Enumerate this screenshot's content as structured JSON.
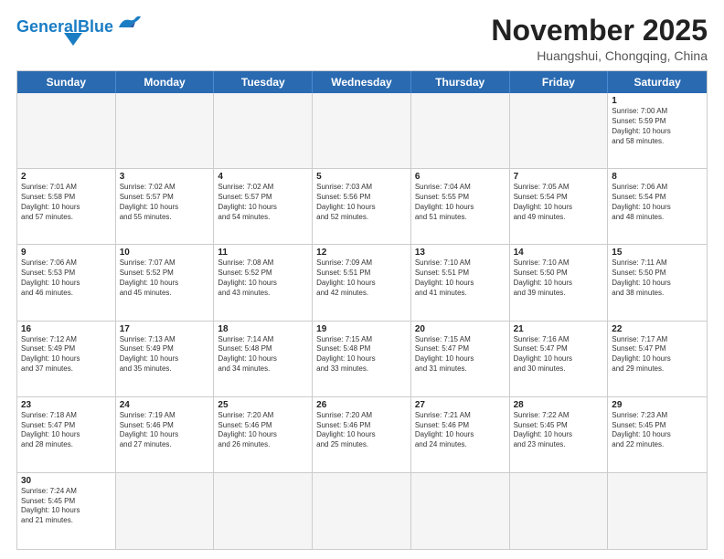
{
  "header": {
    "logo_general": "General",
    "logo_blue": "Blue",
    "month_title": "November 2025",
    "location": "Huangshui, Chongqing, China"
  },
  "days": [
    "Sunday",
    "Monday",
    "Tuesday",
    "Wednesday",
    "Thursday",
    "Friday",
    "Saturday"
  ],
  "cells": [
    {
      "day": "",
      "empty": true,
      "info": ""
    },
    {
      "day": "",
      "empty": true,
      "info": ""
    },
    {
      "day": "",
      "empty": true,
      "info": ""
    },
    {
      "day": "",
      "empty": true,
      "info": ""
    },
    {
      "day": "",
      "empty": true,
      "info": ""
    },
    {
      "day": "",
      "empty": true,
      "info": ""
    },
    {
      "day": "1",
      "empty": false,
      "info": "Sunrise: 7:00 AM\nSunset: 5:59 PM\nDaylight: 10 hours\nand 58 minutes."
    },
    {
      "day": "2",
      "empty": false,
      "info": "Sunrise: 7:01 AM\nSunset: 5:58 PM\nDaylight: 10 hours\nand 57 minutes."
    },
    {
      "day": "3",
      "empty": false,
      "info": "Sunrise: 7:02 AM\nSunset: 5:57 PM\nDaylight: 10 hours\nand 55 minutes."
    },
    {
      "day": "4",
      "empty": false,
      "info": "Sunrise: 7:02 AM\nSunset: 5:57 PM\nDaylight: 10 hours\nand 54 minutes."
    },
    {
      "day": "5",
      "empty": false,
      "info": "Sunrise: 7:03 AM\nSunset: 5:56 PM\nDaylight: 10 hours\nand 52 minutes."
    },
    {
      "day": "6",
      "empty": false,
      "info": "Sunrise: 7:04 AM\nSunset: 5:55 PM\nDaylight: 10 hours\nand 51 minutes."
    },
    {
      "day": "7",
      "empty": false,
      "info": "Sunrise: 7:05 AM\nSunset: 5:54 PM\nDaylight: 10 hours\nand 49 minutes."
    },
    {
      "day": "8",
      "empty": false,
      "info": "Sunrise: 7:06 AM\nSunset: 5:54 PM\nDaylight: 10 hours\nand 48 minutes."
    },
    {
      "day": "9",
      "empty": false,
      "info": "Sunrise: 7:06 AM\nSunset: 5:53 PM\nDaylight: 10 hours\nand 46 minutes."
    },
    {
      "day": "10",
      "empty": false,
      "info": "Sunrise: 7:07 AM\nSunset: 5:52 PM\nDaylight: 10 hours\nand 45 minutes."
    },
    {
      "day": "11",
      "empty": false,
      "info": "Sunrise: 7:08 AM\nSunset: 5:52 PM\nDaylight: 10 hours\nand 43 minutes."
    },
    {
      "day": "12",
      "empty": false,
      "info": "Sunrise: 7:09 AM\nSunset: 5:51 PM\nDaylight: 10 hours\nand 42 minutes."
    },
    {
      "day": "13",
      "empty": false,
      "info": "Sunrise: 7:10 AM\nSunset: 5:51 PM\nDaylight: 10 hours\nand 41 minutes."
    },
    {
      "day": "14",
      "empty": false,
      "info": "Sunrise: 7:10 AM\nSunset: 5:50 PM\nDaylight: 10 hours\nand 39 minutes."
    },
    {
      "day": "15",
      "empty": false,
      "info": "Sunrise: 7:11 AM\nSunset: 5:50 PM\nDaylight: 10 hours\nand 38 minutes."
    },
    {
      "day": "16",
      "empty": false,
      "info": "Sunrise: 7:12 AM\nSunset: 5:49 PM\nDaylight: 10 hours\nand 37 minutes."
    },
    {
      "day": "17",
      "empty": false,
      "info": "Sunrise: 7:13 AM\nSunset: 5:49 PM\nDaylight: 10 hours\nand 35 minutes."
    },
    {
      "day": "18",
      "empty": false,
      "info": "Sunrise: 7:14 AM\nSunset: 5:48 PM\nDaylight: 10 hours\nand 34 minutes."
    },
    {
      "day": "19",
      "empty": false,
      "info": "Sunrise: 7:15 AM\nSunset: 5:48 PM\nDaylight: 10 hours\nand 33 minutes."
    },
    {
      "day": "20",
      "empty": false,
      "info": "Sunrise: 7:15 AM\nSunset: 5:47 PM\nDaylight: 10 hours\nand 31 minutes."
    },
    {
      "day": "21",
      "empty": false,
      "info": "Sunrise: 7:16 AM\nSunset: 5:47 PM\nDaylight: 10 hours\nand 30 minutes."
    },
    {
      "day": "22",
      "empty": false,
      "info": "Sunrise: 7:17 AM\nSunset: 5:47 PM\nDaylight: 10 hours\nand 29 minutes."
    },
    {
      "day": "23",
      "empty": false,
      "info": "Sunrise: 7:18 AM\nSunset: 5:47 PM\nDaylight: 10 hours\nand 28 minutes."
    },
    {
      "day": "24",
      "empty": false,
      "info": "Sunrise: 7:19 AM\nSunset: 5:46 PM\nDaylight: 10 hours\nand 27 minutes."
    },
    {
      "day": "25",
      "empty": false,
      "info": "Sunrise: 7:20 AM\nSunset: 5:46 PM\nDaylight: 10 hours\nand 26 minutes."
    },
    {
      "day": "26",
      "empty": false,
      "info": "Sunrise: 7:20 AM\nSunset: 5:46 PM\nDaylight: 10 hours\nand 25 minutes."
    },
    {
      "day": "27",
      "empty": false,
      "info": "Sunrise: 7:21 AM\nSunset: 5:46 PM\nDaylight: 10 hours\nand 24 minutes."
    },
    {
      "day": "28",
      "empty": false,
      "info": "Sunrise: 7:22 AM\nSunset: 5:45 PM\nDaylight: 10 hours\nand 23 minutes."
    },
    {
      "day": "29",
      "empty": false,
      "info": "Sunrise: 7:23 AM\nSunset: 5:45 PM\nDaylight: 10 hours\nand 22 minutes."
    },
    {
      "day": "30",
      "empty": false,
      "info": "Sunrise: 7:24 AM\nSunset: 5:45 PM\nDaylight: 10 hours\nand 21 minutes."
    },
    {
      "day": "",
      "empty": true,
      "info": ""
    },
    {
      "day": "",
      "empty": true,
      "info": ""
    },
    {
      "day": "",
      "empty": true,
      "info": ""
    },
    {
      "day": "",
      "empty": true,
      "info": ""
    },
    {
      "day": "",
      "empty": true,
      "info": ""
    },
    {
      "day": "",
      "empty": true,
      "info": ""
    }
  ]
}
